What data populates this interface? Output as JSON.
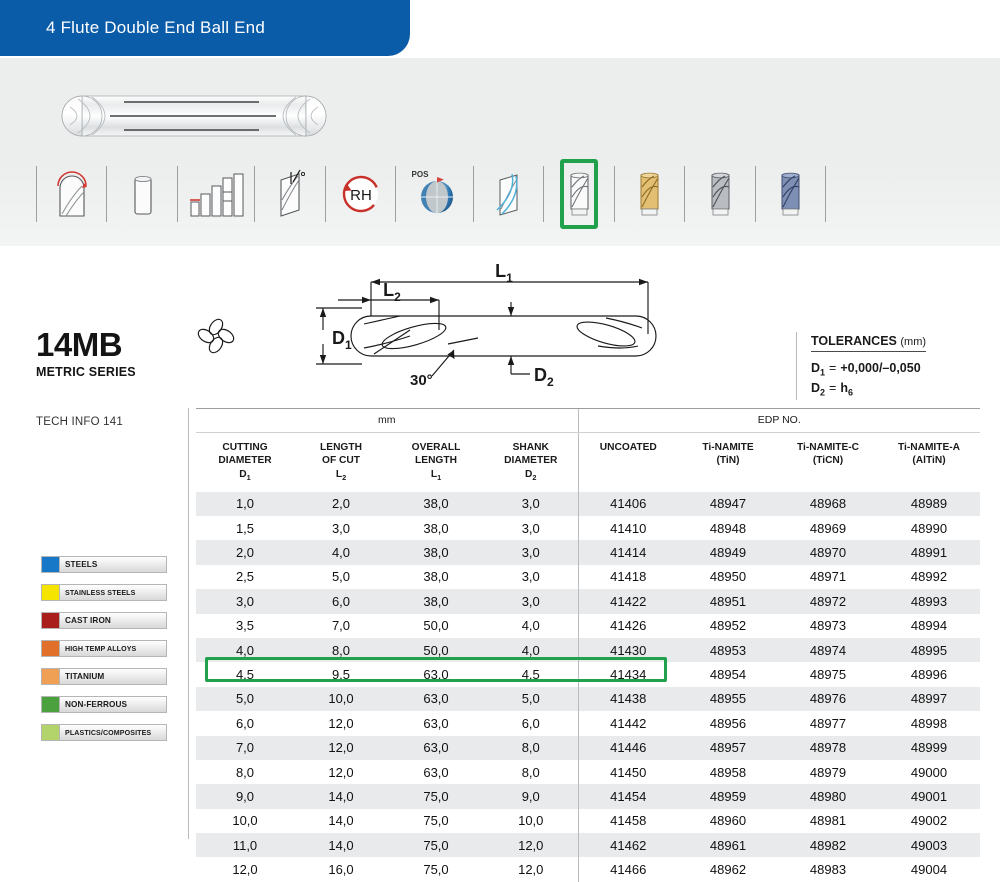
{
  "banner": {
    "title": "4 Flute Double End Ball End"
  },
  "product": {
    "photo_alt": "double-end-ball-end-mill",
    "icons": [
      {
        "name": "ball-nose-end-icon",
        "label": "BALL NOSE END",
        "selected": false
      },
      {
        "name": "straight-shank-icon",
        "label": "STRAIGHT SHANK",
        "selected": false
      },
      {
        "name": "step-depth-chart-icon",
        "label": "DEPTH OF CUT CHART",
        "selected": false
      },
      {
        "name": "helix-angle-icon",
        "label": "HELIX ANGLE",
        "selected": false
      },
      {
        "name": "right-hand-rotation-icon",
        "label": "RH",
        "selected": false
      },
      {
        "name": "positive-rake-sphere-icon",
        "label": "POS",
        "selected": false
      },
      {
        "name": "coolant-flute-icon",
        "label": "FLUTE PROFILE",
        "selected": false
      },
      {
        "name": "uncoated-tool-icon",
        "label": "UNCOATED",
        "selected": true
      },
      {
        "name": "tin-coated-tool-icon",
        "label": "Ti-NAMITE (TiN)",
        "selected": false
      },
      {
        "name": "ticn-coated-tool-icon",
        "label": "Ti-NAMITE-C (TiCN)",
        "selected": false
      },
      {
        "name": "altin-coated-tool-icon",
        "label": "Ti-NAMITE-A (AlTiN)",
        "selected": false
      }
    ],
    "rh_label": "RH",
    "pos_label": "POS"
  },
  "series": {
    "code": "14MB",
    "subtitle": "METRIC SERIES",
    "tech_info": "TECH INFO 141"
  },
  "diagram": {
    "l1": "L",
    "l1_sub": "1",
    "l2": "L",
    "l2_sub": "2",
    "d1": "D",
    "d1_sub": "1",
    "d2": "D",
    "d2_sub": "2",
    "angle": "30°"
  },
  "tolerances": {
    "title": "TOLERANCES",
    "unit": "(mm)",
    "lines": [
      {
        "sym": "D",
        "sub": "1",
        "eq": "=",
        "value": "+0,000/–0,050"
      },
      {
        "sym": "D",
        "sub": "2",
        "eq": "=",
        "value": "h",
        "value_sub": "6"
      }
    ]
  },
  "legend": {
    "items": [
      {
        "label": "STEELS",
        "color": "#1878c8"
      },
      {
        "label": "STAINLESS STEELS",
        "color": "#f5e400"
      },
      {
        "label": "CAST IRON",
        "color": "#a81f1c"
      },
      {
        "label": "HIGH TEMP ALLOYS",
        "color": "#e0702a"
      },
      {
        "label": "TITANIUM",
        "color": "#f0a055"
      },
      {
        "label": "NON-FERROUS",
        "color": "#4ba13e"
      },
      {
        "label": "PLASTICS/COMPOSITES",
        "color": "#b2d46a"
      }
    ]
  },
  "table": {
    "group_headers": [
      {
        "label": "mm",
        "span": 4
      },
      {
        "label": "EDP NO.",
        "span": 4
      }
    ],
    "columns": [
      {
        "line1": "CUTTING",
        "line2": "DIAMETER",
        "sym": "D",
        "sub": "1"
      },
      {
        "line1": "LENGTH",
        "line2": "OF CUT",
        "sym": "L",
        "sub": "2"
      },
      {
        "line1": "OVERALL",
        "line2": "LENGTH",
        "sym": "L",
        "sub": "1"
      },
      {
        "line1": "SHANK",
        "line2": "DIAMETER",
        "sym": "D",
        "sub": "2"
      },
      {
        "line1": "UNCOATED",
        "line2": "",
        "sym": "",
        "sub": ""
      },
      {
        "line1": "Ti-NAMITE",
        "line2": "(TiN)",
        "sym": "",
        "sub": ""
      },
      {
        "line1": "Ti-NAMITE-C",
        "line2": "(TiCN)",
        "sym": "",
        "sub": ""
      },
      {
        "line1": "Ti-NAMITE-A",
        "line2": "(AlTiN)",
        "sym": "",
        "sub": ""
      }
    ],
    "rows": [
      {
        "d1": "1,0",
        "l2": "2,0",
        "l1": "38,0",
        "d2": "3,0",
        "uncoated": "41406",
        "tin": "48947",
        "ticn": "48968",
        "altin": "48989",
        "highlight": false
      },
      {
        "d1": "1,5",
        "l2": "3,0",
        "l1": "38,0",
        "d2": "3,0",
        "uncoated": "41410",
        "tin": "48948",
        "ticn": "48969",
        "altin": "48990",
        "highlight": false
      },
      {
        "d1": "2,0",
        "l2": "4,0",
        "l1": "38,0",
        "d2": "3,0",
        "uncoated": "41414",
        "tin": "48949",
        "ticn": "48970",
        "altin": "48991",
        "highlight": false
      },
      {
        "d1": "2,5",
        "l2": "5,0",
        "l1": "38,0",
        "d2": "3,0",
        "uncoated": "41418",
        "tin": "48950",
        "ticn": "48971",
        "altin": "48992",
        "highlight": false
      },
      {
        "d1": "3,0",
        "l2": "6,0",
        "l1": "38,0",
        "d2": "3,0",
        "uncoated": "41422",
        "tin": "48951",
        "ticn": "48972",
        "altin": "48993",
        "highlight": false
      },
      {
        "d1": "3,5",
        "l2": "7,0",
        "l1": "50,0",
        "d2": "4,0",
        "uncoated": "41426",
        "tin": "48952",
        "ticn": "48973",
        "altin": "48994",
        "highlight": false
      },
      {
        "d1": "4,0",
        "l2": "8,0",
        "l1": "50,0",
        "d2": "4,0",
        "uncoated": "41430",
        "tin": "48953",
        "ticn": "48974",
        "altin": "48995",
        "highlight": false
      },
      {
        "d1": "4,5",
        "l2": "9,5",
        "l1": "63,0",
        "d2": "4,5",
        "uncoated": "41434",
        "tin": "48954",
        "ticn": "48975",
        "altin": "48996",
        "highlight": false
      },
      {
        "d1": "5,0",
        "l2": "10,0",
        "l1": "63,0",
        "d2": "5,0",
        "uncoated": "41438",
        "tin": "48955",
        "ticn": "48976",
        "altin": "48997",
        "highlight": true
      },
      {
        "d1": "6,0",
        "l2": "12,0",
        "l1": "63,0",
        "d2": "6,0",
        "uncoated": "41442",
        "tin": "48956",
        "ticn": "48977",
        "altin": "48998",
        "highlight": false
      },
      {
        "d1": "7,0",
        "l2": "12,0",
        "l1": "63,0",
        "d2": "8,0",
        "uncoated": "41446",
        "tin": "48957",
        "ticn": "48978",
        "altin": "48999",
        "highlight": false
      },
      {
        "d1": "8,0",
        "l2": "12,0",
        "l1": "63,0",
        "d2": "8,0",
        "uncoated": "41450",
        "tin": "48958",
        "ticn": "48979",
        "altin": "49000",
        "highlight": false
      },
      {
        "d1": "9,0",
        "l2": "14,0",
        "l1": "75,0",
        "d2": "9,0",
        "uncoated": "41454",
        "tin": "48959",
        "ticn": "48980",
        "altin": "49001",
        "highlight": false
      },
      {
        "d1": "10,0",
        "l2": "14,0",
        "l1": "75,0",
        "d2": "10,0",
        "uncoated": "41458",
        "tin": "48960",
        "ticn": "48981",
        "altin": "49002",
        "highlight": false
      },
      {
        "d1": "11,0",
        "l2": "14,0",
        "l1": "75,0",
        "d2": "12,0",
        "uncoated": "41462",
        "tin": "48961",
        "ticn": "48982",
        "altin": "49003",
        "highlight": false
      },
      {
        "d1": "12,0",
        "l2": "16,0",
        "l1": "75,0",
        "d2": "12,0",
        "uncoated": "41466",
        "tin": "48962",
        "ticn": "48983",
        "altin": "49004",
        "highlight": false
      }
    ]
  }
}
